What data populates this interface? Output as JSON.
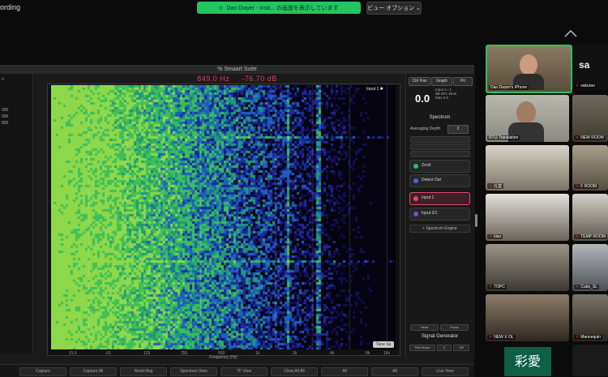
{
  "meeting": {
    "top_left_label": "ording",
    "share_banner": "Dan Dwyer - Insit... の画面を表示しています",
    "view_options": "ビュー オプション ⌄"
  },
  "window": {
    "title": "% Smaart Suite",
    "readout_freq": "849.0 Hz",
    "readout_level": "-76.70 dB"
  },
  "left_panel": {
    "rows": [
      "n",
      "",
      "",
      "000",
      "000",
      "800",
      "",
      ""
    ]
  },
  "plot": {
    "input_label": "Input 1 ✱",
    "tune_button": "Tune Sp",
    "x_axis_label": "Frequency (Hz)",
    "freq_ticks": [
      "31.5",
      "63",
      "125",
      "250",
      "500",
      "1k",
      "2k",
      "4k",
      "8k",
      "16k"
    ]
  },
  "right_panel": {
    "tabs": [
      "Ctrl Pan",
      "Graph",
      "Pri"
    ],
    "rt_value": "0.0",
    "rt_info": [
      "Input 1 / 1",
      "dB SPL Slow",
      "Max 0.0"
    ],
    "spectrum_header": "Spectrum",
    "avg_label": "Averaging Depth",
    "avg_value": "2",
    "measurements": [
      {
        "label": "Zoolt",
        "led": "#22c55e"
      },
      {
        "label": "Detect Out",
        "led": "#3b6ed8"
      },
      {
        "label": "Input 1",
        "led": "#e4476a"
      },
      {
        "label": "Input 2/1",
        "led": "#8b3fe0"
      }
    ],
    "add_button": "+ Spectrum Engine",
    "sig_buttons": [
      "Head",
      "Pause"
    ],
    "siggen_header": "Signal Generator",
    "sig_row": [
      "Pink Noise",
      "0",
      "Off"
    ]
  },
  "bottom_bar": {
    "buttons": [
      "Capture",
      "Capture All",
      "Reset Avg",
      "Spectrum View",
      "TF View",
      "Clear All All",
      "All",
      "All",
      "Live View",
      ""
    ]
  },
  "participants": [
    {
      "name": "Dan Dwyer's iPhone",
      "mic_off": false
    },
    {
      "name": "sakurao",
      "mic_off": true
    },
    {
      "name": "RTIJ Translation",
      "mic_off": false
    },
    {
      "name": "NEW ROOM",
      "mic_off": true
    },
    {
      "name": "礼堂",
      "mic_off": true
    },
    {
      "name": "F ROOM",
      "mic_off": true
    },
    {
      "name": "kiso",
      "mic_off": true
    },
    {
      "name": "TEMP ROOM",
      "mic_off": true
    },
    {
      "name": "TOPC",
      "mic_off": true
    },
    {
      "name": "Cube_SL",
      "mic_off": true
    },
    {
      "name": "NEW X OL",
      "mic_off": true
    },
    {
      "name": "Mannequin",
      "mic_off": true
    }
  ],
  "side_letter": "sa",
  "kanji_panel": "彩愛",
  "colors": {
    "accent": "#22c55e",
    "readout": "#e0405a",
    "measure_active": "#e4476a"
  }
}
